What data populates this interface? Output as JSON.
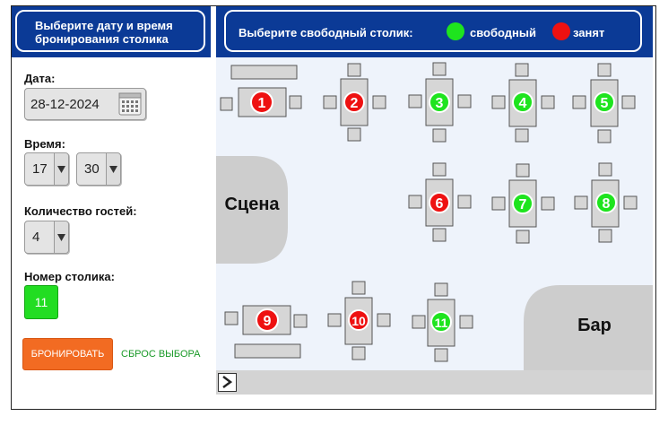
{
  "left_header": {
    "line1": "Выберите дату и время",
    "line2": "бронирования  столика"
  },
  "date": {
    "label": "Дата:",
    "value": "28-12-2024"
  },
  "time": {
    "label": "Время:",
    "hour": "17",
    "minute": "30"
  },
  "guests": {
    "label": "Количество гостей:",
    "value": "4"
  },
  "table_number": {
    "label": "Номер столика:",
    "value": "11"
  },
  "actions": {
    "book": "БРОНИРОВАТЬ",
    "reset": "СБРОС ВЫБОРА"
  },
  "right_header": {
    "title": "Выберите свободный столик:",
    "free": "свободный",
    "taken": "занят"
  },
  "areas": {
    "stage": "Сцена",
    "bar": "Бар"
  },
  "colors": {
    "free": "#1ee41e",
    "taken": "#ee1111",
    "header": "#0b3a96",
    "accent": "#f26b22"
  },
  "tables": [
    {
      "number": "1",
      "status": "taken"
    },
    {
      "number": "2",
      "status": "taken"
    },
    {
      "number": "3",
      "status": "free"
    },
    {
      "number": "4",
      "status": "free"
    },
    {
      "number": "5",
      "status": "free"
    },
    {
      "number": "6",
      "status": "taken"
    },
    {
      "number": "7",
      "status": "free"
    },
    {
      "number": "8",
      "status": "free"
    },
    {
      "number": "9",
      "status": "taken"
    },
    {
      "number": "10",
      "status": "taken"
    },
    {
      "number": "11",
      "status": "free"
    }
  ]
}
